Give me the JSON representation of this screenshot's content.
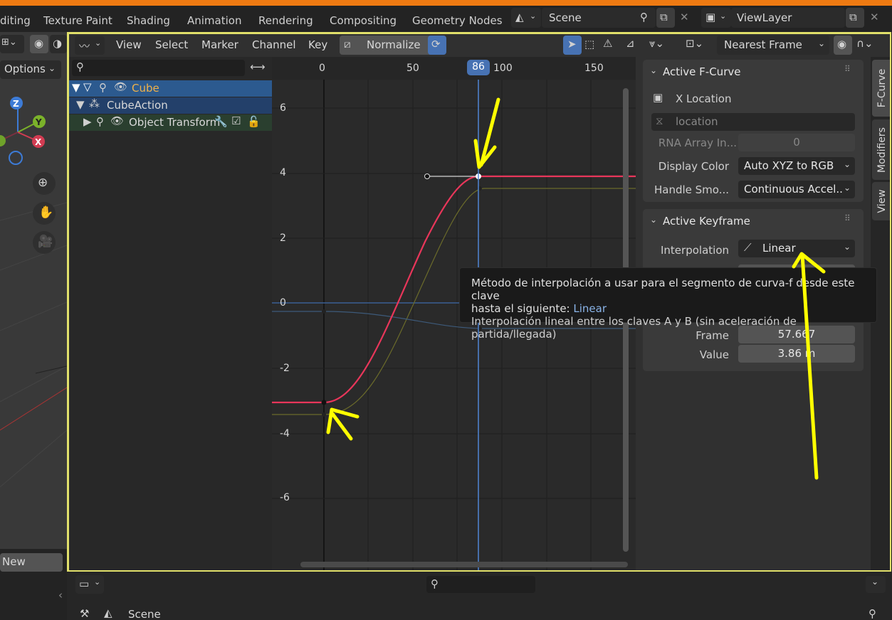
{
  "topbar": {
    "workspaces": [
      "diting",
      "Texture Paint",
      "Shading",
      "Animation",
      "Rendering",
      "Compositing",
      "Geometry Nodes"
    ],
    "scene": "Scene",
    "view_layer": "ViewLayer"
  },
  "left_panel": {
    "options_label": "Options",
    "new_label": "New",
    "axes": [
      "Z",
      "Y",
      "X"
    ]
  },
  "header": {
    "menus": [
      "View",
      "Select",
      "Marker",
      "Channel",
      "Key"
    ],
    "normalize": "Normalize",
    "snap": "Nearest Frame"
  },
  "channels": {
    "rows": [
      {
        "label": "Cube"
      },
      {
        "label": "CubeAction"
      },
      {
        "label": "Object Transform"
      }
    ]
  },
  "graph": {
    "frame_ticks": [
      "0",
      "50",
      "100",
      "150"
    ],
    "current_frame": "86",
    "value_ticks": [
      "6",
      "4",
      "2",
      "0",
      "-2",
      "-4",
      "-6"
    ]
  },
  "sidebar": {
    "fcurve_panel": {
      "title": "Active F-Curve",
      "channel_name": "X Location",
      "data_path": "location",
      "rna_array_label": "RNA Array In...",
      "rna_array_value": "0",
      "display_color_label": "Display Color",
      "display_color_value": "Auto XYZ to RGB",
      "handle_smoothing_label": "Handle Smo...",
      "handle_smoothing_value": "Continuous Accel..."
    },
    "keyframe_panel": {
      "title": "Active Keyframe",
      "interpolation_label": "Interpolation",
      "interpolation_value": "Linear",
      "frame_label": "Frame",
      "frame_value": "57.667",
      "value_label": "Value",
      "value_value": "3.86 m"
    },
    "tabs": [
      "F-Curve",
      "Modifiers",
      "View"
    ]
  },
  "tooltip": {
    "line1": "Método de interpolación a usar para el segmento de curva-f desde este clave",
    "line2_prefix": "hasta el siguiente:",
    "line2_value": "Linear",
    "line3": "Interpolación lineal entre los claves A y B (sin aceleración de partida/llegada)"
  },
  "bottom": {
    "scene": "Scene"
  },
  "colors": {
    "accent_orange": "#ee7a12",
    "editor_border": "#e1e06a",
    "selection_blue": "#4772b3",
    "x_curve": "#e8365a",
    "annotation": "#ffff00"
  }
}
